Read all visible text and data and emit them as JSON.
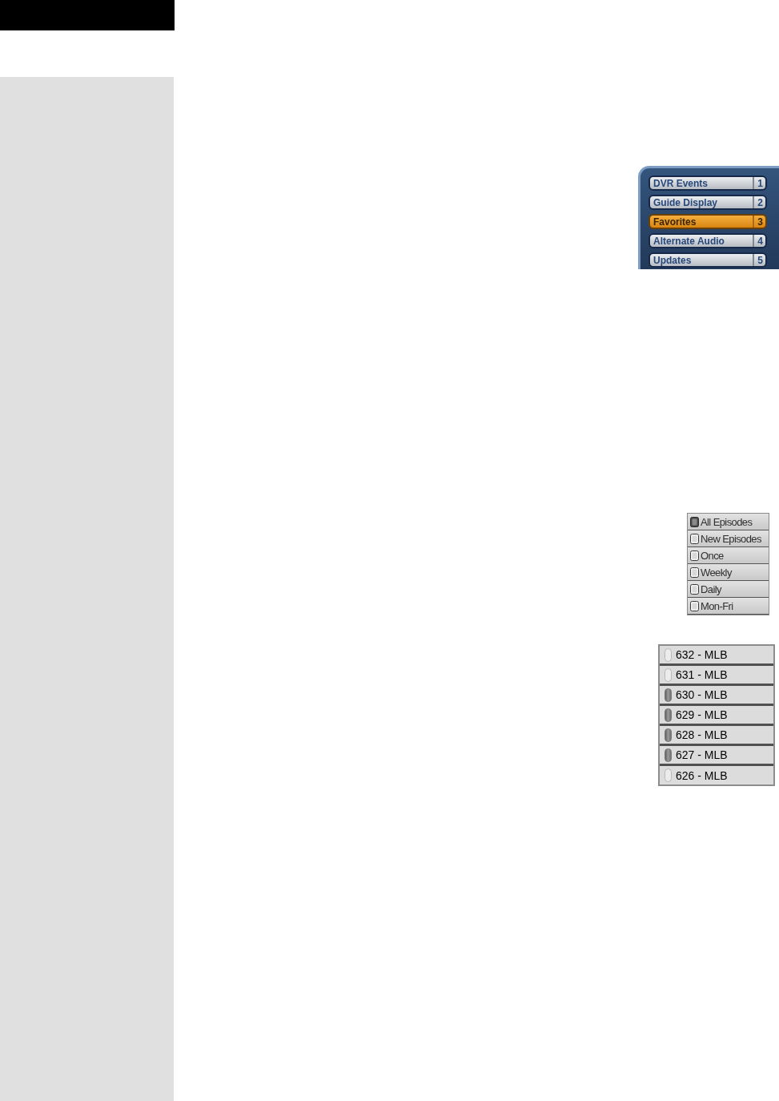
{
  "favorites_menu": {
    "items": [
      {
        "label": "DVR Events",
        "number": "1",
        "selected": false
      },
      {
        "label": "Guide Display",
        "number": "2",
        "selected": false
      },
      {
        "label": "Favorites",
        "number": "3",
        "selected": true
      },
      {
        "label": "Alternate Audio",
        "number": "4",
        "selected": false
      },
      {
        "label": "Updates",
        "number": "5",
        "selected": false
      }
    ]
  },
  "record_options": {
    "items": [
      {
        "label": "All Episodes",
        "selected": true
      },
      {
        "label": "New Episodes",
        "selected": false
      },
      {
        "label": "Once",
        "selected": false
      },
      {
        "label": "Weekly",
        "selected": false
      },
      {
        "label": "Daily",
        "selected": false
      },
      {
        "label": "Mon-Fri",
        "selected": false
      }
    ]
  },
  "channel_list": {
    "items": [
      {
        "label": "632 - MLB",
        "checked": false
      },
      {
        "label": "631 - MLB",
        "checked": false
      },
      {
        "label": "630 - MLB",
        "checked": true
      },
      {
        "label": "629 - MLB",
        "checked": true
      },
      {
        "label": "628 - MLB",
        "checked": true
      },
      {
        "label": "627 - MLB",
        "checked": true
      },
      {
        "label": "626 - MLB",
        "checked": false
      }
    ]
  }
}
